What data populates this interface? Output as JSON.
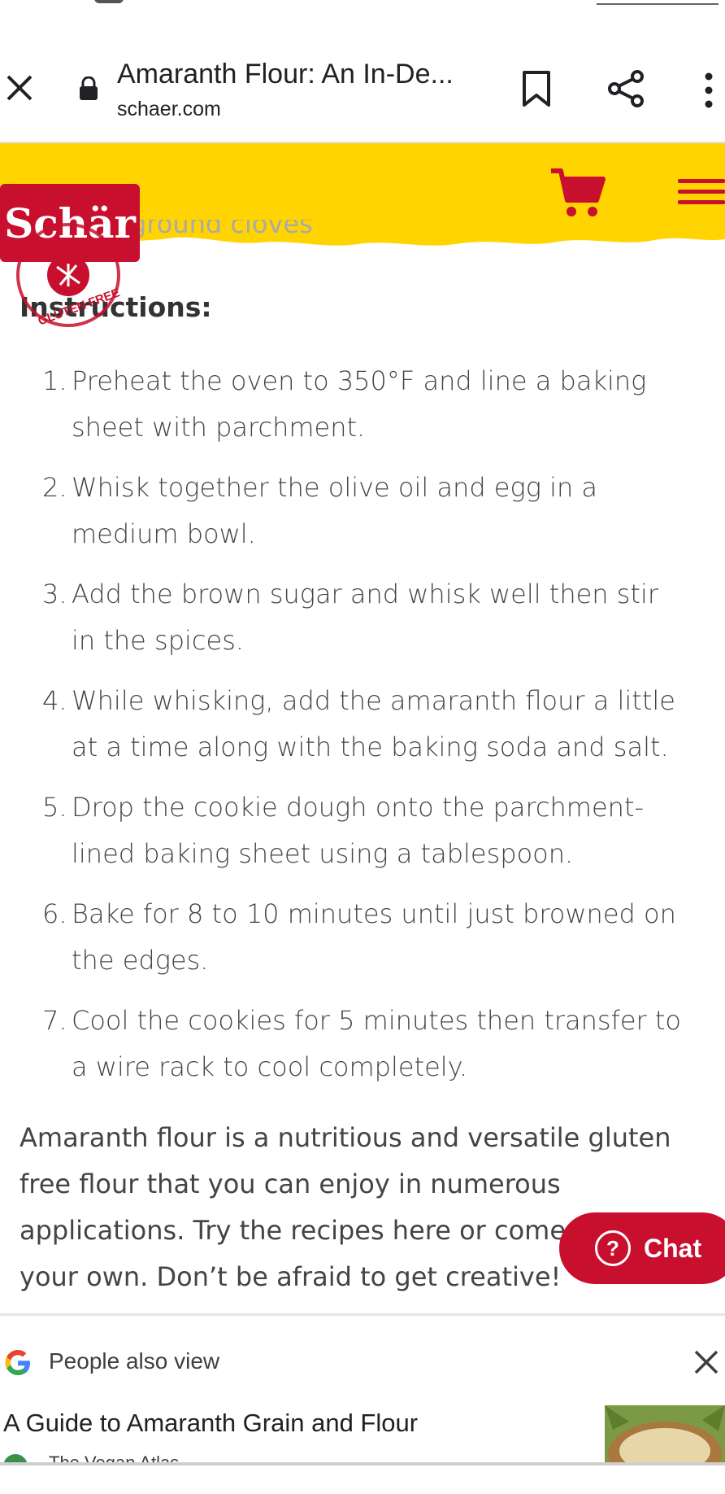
{
  "browser": {
    "page_title": "Amaranth Flour: An In-De...",
    "domain": "schaer.com"
  },
  "site": {
    "logo_text": "Schär",
    "logo_sub": "GLUTEN FREE",
    "colors": {
      "yellow": "#FFD400",
      "red": "#C8102E"
    }
  },
  "content": {
    "section_heading": "Instructions:",
    "peek_text": "ground cloves",
    "steps": [
      {
        "num": "1.",
        "text": "Preheat the oven to 350°F and line a baking sheet with parchment."
      },
      {
        "num": "2.",
        "text": "Whisk together the olive oil and egg in a medium bowl."
      },
      {
        "num": "3.",
        "text": "Add the brown sugar and whisk well then stir in the spices."
      },
      {
        "num": "4.",
        "text": "While whisking, add the amaranth flour a little at a time along with the baking soda and salt."
      },
      {
        "num": "5.",
        "text": "Drop the cookie dough onto the parchment-lined baking sheet using a tablespoon."
      },
      {
        "num": "6.",
        "text": "Bake for 8 to 10 minutes until just browned on the edges."
      },
      {
        "num": "7.",
        "text": "Cool the cookies for 5 minutes then transfer to a wire rack to cool completely."
      }
    ],
    "closing_paragraph": "Amaranth flour is a nutritious and versatile gluten free flour that you can enjoy in numerous applications. Try the recipes here or come up with your own. Don’t be afraid to get creative!"
  },
  "chat": {
    "label": "Chat"
  },
  "suggestion_sheet": {
    "header": "People also view",
    "result_title": "A Guide to Amaranth Grain and Flour",
    "result_source": "The Vegan Atlas"
  }
}
